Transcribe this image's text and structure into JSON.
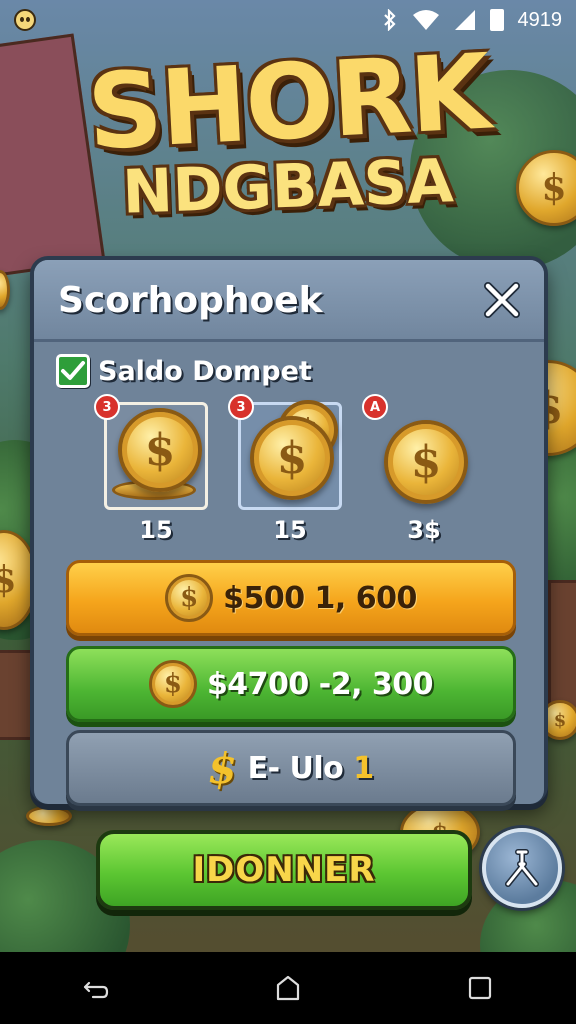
{
  "status_bar": {
    "time": "4919",
    "icons": [
      "skull-icon",
      "bluetooth-icon",
      "wifi-icon",
      "signal-icon",
      "battery-icon"
    ]
  },
  "game_title": {
    "line1": "SHORK",
    "line2": "NDGBASA"
  },
  "dialog": {
    "title": "Scorhophoek",
    "wallet_label": "Saldo Dompet",
    "wallet_checked": true,
    "coin_packs": [
      {
        "badge": "3",
        "amount": "15",
        "style": "white-frame",
        "icon": "coin-stack-icon"
      },
      {
        "badge": "3",
        "amount": "15",
        "style": "blue-frame",
        "icon": "coin-stack-icon"
      },
      {
        "badge": "A",
        "amount": "3$",
        "style": "no-frame",
        "icon": "coin-icon"
      }
    ],
    "buy_options": [
      {
        "label": "$500 1, 600",
        "color": "#f5a51c",
        "icon": "coin-icon"
      },
      {
        "label": "$4700 -2, 300",
        "color": "#4db633",
        "icon": "coin-icon"
      },
      {
        "label_prefix": "E- Ulo",
        "label_suffix": "1",
        "color": "#7b8b9e",
        "icon": "dollar-icon"
      }
    ],
    "coin_symbol": "$"
  },
  "actions": {
    "confirm_label": "IDONNER",
    "tools_icon": "tools-icon"
  },
  "nav": [
    "back-icon",
    "home-icon",
    "recents-icon"
  ],
  "colors": {
    "accent_gold": "#fbd96a",
    "panel_bg": "#7a8ea6",
    "confirm_green": "#5cc632"
  }
}
